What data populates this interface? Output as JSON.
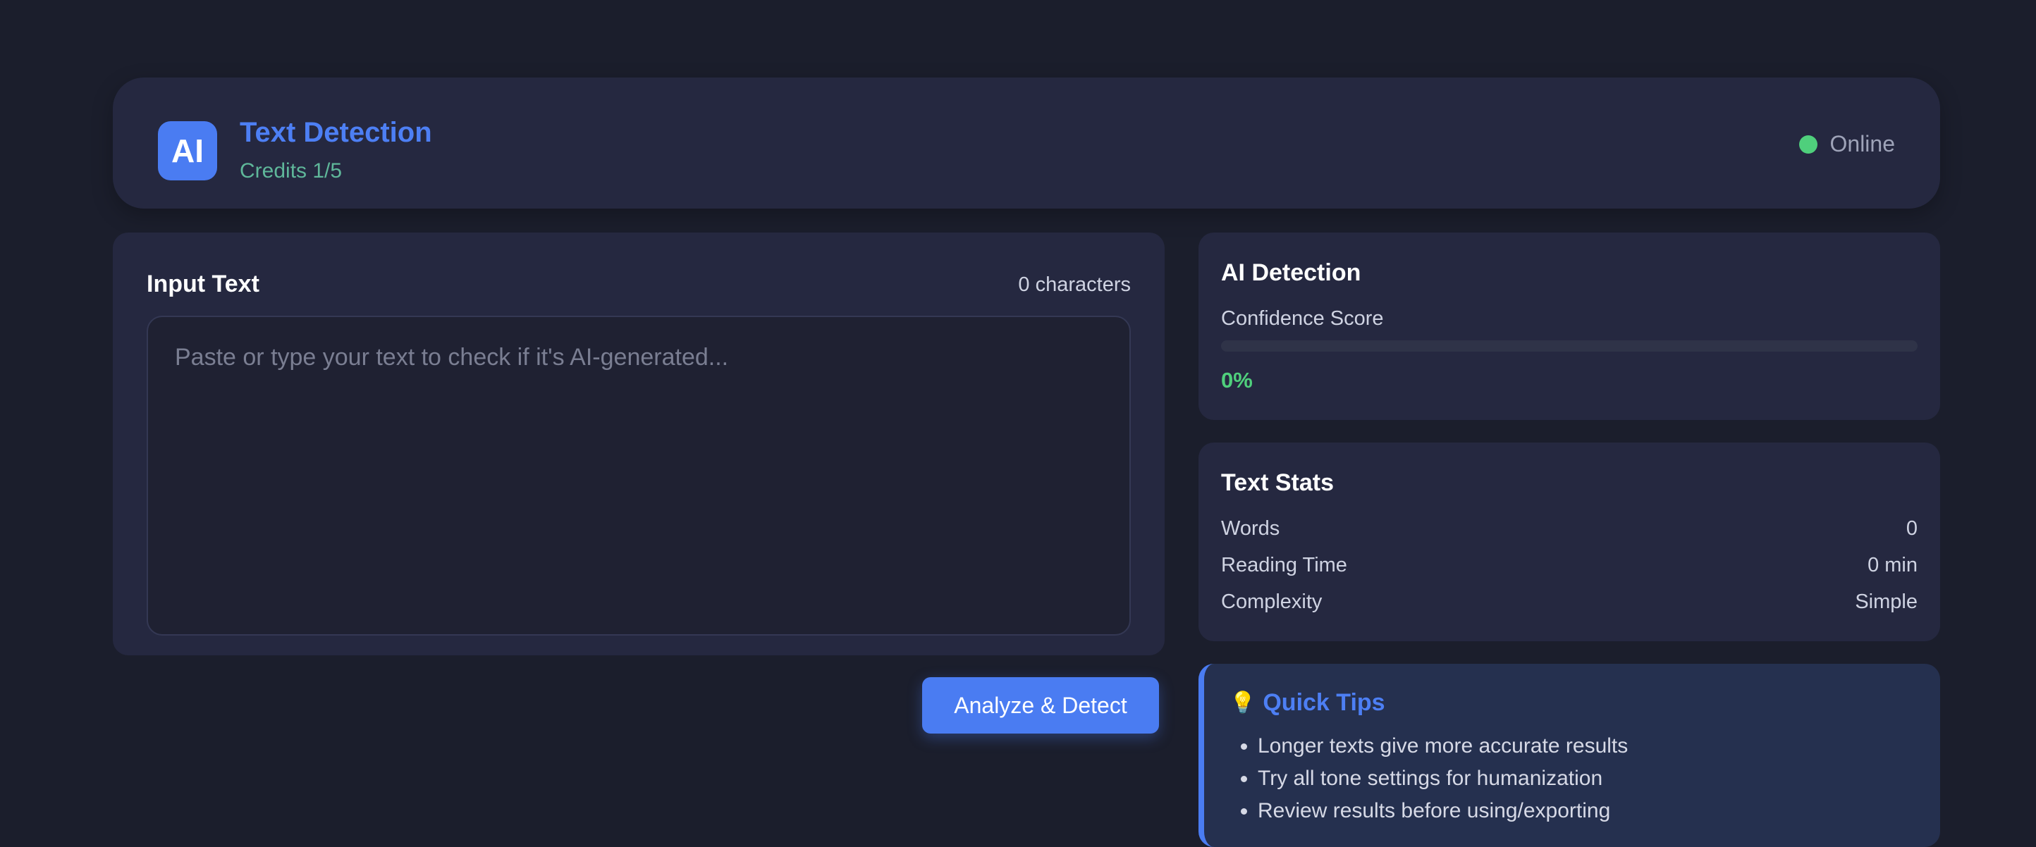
{
  "header": {
    "logo_text": "AI",
    "title": "Text Detection",
    "credits": "Credits 1/5",
    "status": "Online"
  },
  "input": {
    "title": "Input Text",
    "char_count": "0 characters",
    "placeholder": "Paste or type your text to check if it's AI-generated...",
    "value": ""
  },
  "actions": {
    "analyze_label": "Analyze & Detect"
  },
  "detection": {
    "title": "AI Detection",
    "confidence_label": "Confidence Score",
    "confidence_value": "0%",
    "confidence_fraction": 0
  },
  "stats": {
    "title": "Text Stats",
    "rows": [
      {
        "label": "Words",
        "value": "0"
      },
      {
        "label": "Reading Time",
        "value": "0 min"
      },
      {
        "label": "Complexity",
        "value": "Simple"
      }
    ]
  },
  "tips": {
    "title": "Quick Tips",
    "items": [
      "Longer texts give more accurate results",
      "Try all tone settings for humanization",
      "Review results before using/exporting"
    ]
  },
  "colors": {
    "accent": "#4a7cf2",
    "success": "#4fcf7c",
    "background": "#1b1e2c",
    "card": "#252840"
  },
  "icons": {
    "status": "online-dot-icon",
    "tips": "lightbulb-icon"
  }
}
